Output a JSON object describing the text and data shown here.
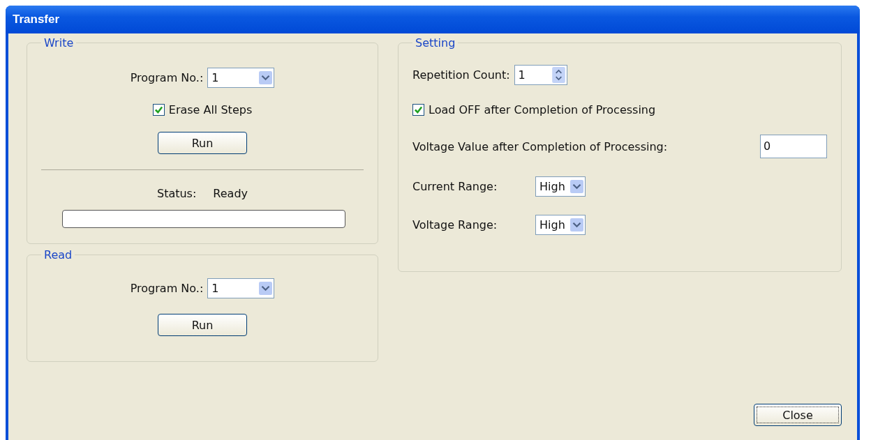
{
  "window": {
    "title": "Transfer"
  },
  "write": {
    "title": "Write",
    "program_label": "Program No.:",
    "program_value": "1",
    "erase": {
      "label": "Erase All Steps",
      "checked": true
    },
    "run": "Run",
    "status_label": "Status:",
    "status_value": "Ready",
    "progress": {
      "level": 0
    }
  },
  "read": {
    "title": "Read",
    "program_label": "Program No.:",
    "program_value": "1",
    "run": "Run"
  },
  "setting": {
    "title": "Setting",
    "repetition_label": "Repetition Count:",
    "repetition_value": "1",
    "load_off": {
      "label": "Load OFF after Completion of Processing",
      "checked": true
    },
    "voltage_value_label": "Voltage Value after Completion of Processing:",
    "voltage_value": "0",
    "current_range_label": "Current Range:",
    "current_range": "High",
    "voltage_range_label": "Voltage Range:",
    "voltage_range": "High"
  },
  "close": "Close"
}
